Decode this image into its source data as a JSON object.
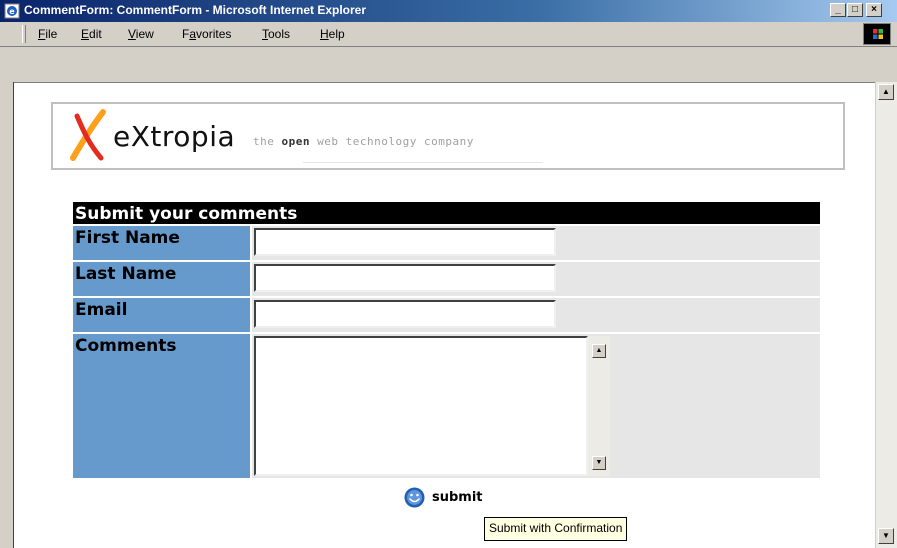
{
  "window": {
    "title": "CommentForm: CommentForm - Microsoft Internet Explorer",
    "minimize": "_",
    "maximize": "□",
    "close": "×"
  },
  "menu": {
    "items": [
      {
        "mnemonic": "F",
        "rest": "ile"
      },
      {
        "mnemonic": "E",
        "rest": "dit"
      },
      {
        "mnemonic": "V",
        "rest": "iew"
      },
      {
        "pre": "F",
        "mnemonic": "a",
        "rest": "vorites"
      },
      {
        "mnemonic": "T",
        "rest": "ools"
      },
      {
        "mnemonic": "H",
        "rest": "elp"
      }
    ]
  },
  "banner": {
    "logo_text": "eXtropia",
    "tagline_pre": "the ",
    "tagline_bold": "open",
    "tagline_post": " web technology company"
  },
  "form": {
    "header": "Submit your comments",
    "fields": {
      "first_name": {
        "label": "First Name",
        "value": ""
      },
      "last_name": {
        "label": "Last Name",
        "value": ""
      },
      "email": {
        "label": "Email",
        "value": ""
      },
      "comments": {
        "label": "Comments",
        "value": ""
      }
    },
    "submit_label": "submit",
    "tooltip": "Submit with Confirmation"
  },
  "colors": {
    "label_bg": "#6699cc",
    "field_bg": "#e6e6e6",
    "header_bg": "#000000"
  },
  "icons": {
    "browser": "ie-page-icon",
    "logo": "extropia-x-logo",
    "submit": "smiley-icon",
    "windows": "windows-flag-icon"
  }
}
